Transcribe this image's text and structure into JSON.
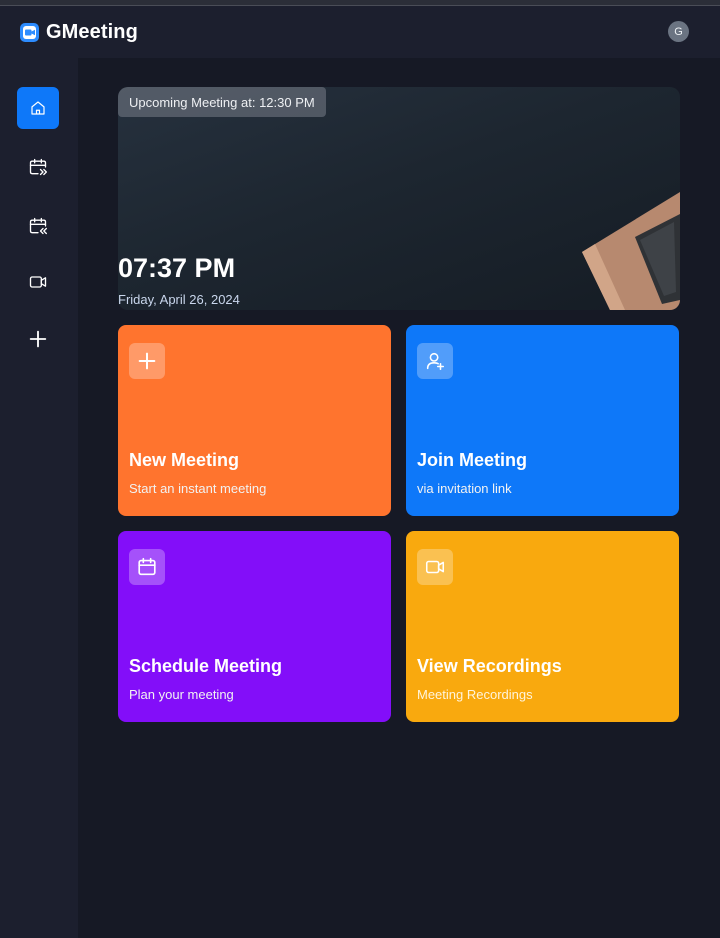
{
  "app": {
    "title": "GMeeting",
    "user_initial": "G"
  },
  "sidebar": {
    "items": [
      {
        "name": "home",
        "icon": "home-icon",
        "active": true
      },
      {
        "name": "upcoming",
        "icon": "calendar-forward-icon",
        "active": false
      },
      {
        "name": "previous",
        "icon": "calendar-back-icon",
        "active": false
      },
      {
        "name": "recordings",
        "icon": "video-icon",
        "active": false
      },
      {
        "name": "personal-room",
        "icon": "plus-icon",
        "active": false
      }
    ]
  },
  "hero": {
    "badge": "Upcoming Meeting at: 12:30 PM",
    "time": "07:37 PM",
    "date": "Friday, April 26, 2024"
  },
  "cards": [
    {
      "title": "New Meeting",
      "subtitle": "Start an instant meeting",
      "icon": "plus-icon",
      "color": "#ff742e"
    },
    {
      "title": "Join Meeting",
      "subtitle": "via invitation link",
      "icon": "user-add-icon",
      "color": "#0e78f9"
    },
    {
      "title": "Schedule Meeting",
      "subtitle": "Plan your meeting",
      "icon": "calendar-icon",
      "color": "#830ef9"
    },
    {
      "title": "View Recordings",
      "subtitle": "Meeting Recordings",
      "icon": "video-icon",
      "color": "#f9a90e"
    }
  ],
  "colors": {
    "navbar": "#1c1f2e",
    "background": "#161925",
    "accent": "#0e78f9"
  }
}
